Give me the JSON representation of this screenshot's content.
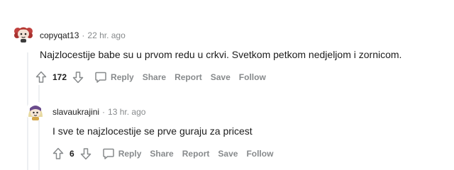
{
  "comments": [
    {
      "username": "copyqat13",
      "separator": "·",
      "time": "22 hr. ago",
      "body": "Najzlocestije babe su u prvom redu u crkvi. Svetkom petkom nedjeljom i zornicom.",
      "score": "172",
      "actions": {
        "reply": "Reply",
        "share": "Share",
        "report": "Report",
        "save": "Save",
        "follow": "Follow"
      }
    },
    {
      "username": "slavaukrajini",
      "separator": "·",
      "time": "13 hr. ago",
      "body": "I sve te najzlocestije se prve guraju za pricest",
      "score": "6",
      "actions": {
        "reply": "Reply",
        "share": "Share",
        "report": "Report",
        "save": "Save",
        "follow": "Follow"
      }
    }
  ],
  "colors": {
    "meta": "#878a8c",
    "text": "#1c1c1c",
    "thread_line": "#edeff1"
  },
  "icons": {
    "upvote": "upvote-arrow-icon",
    "downvote": "downvote-arrow-icon",
    "reply": "speech-bubble-icon"
  }
}
